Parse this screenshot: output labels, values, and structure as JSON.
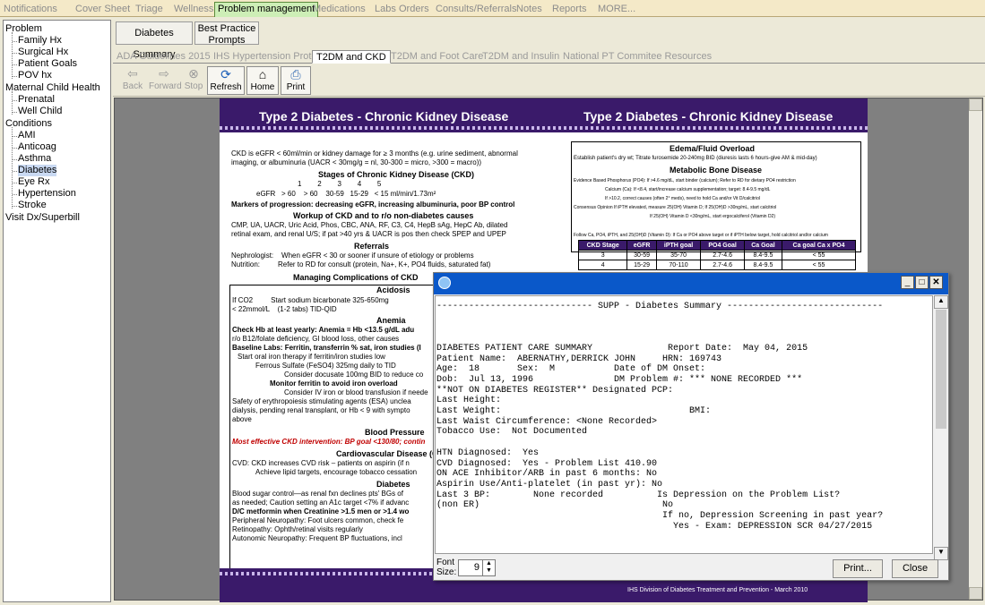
{
  "top_tabs": [
    "Notifications",
    "Cover Sheet",
    "Triage",
    "Wellness",
    "Problem management",
    "Medications",
    "Labs",
    "Orders",
    "Consults/Referrals",
    "Notes",
    "Reports",
    "MORE..."
  ],
  "tree": {
    "problem": "Problem",
    "problem_children": [
      "Family Hx",
      "Surgical Hx",
      "Patient Goals",
      "POV hx"
    ],
    "maternal": "Maternal Child Health",
    "maternal_children": [
      "Prenatal",
      "Well Child"
    ],
    "conditions": "Conditions",
    "condition_children": [
      "AMI",
      "Anticoag",
      "Asthma",
      "Diabetes",
      "Eye Rx",
      "Hypertension",
      "Stroke"
    ],
    "visit": "Visit Dx/Superbill"
  },
  "buttons": {
    "summary": "Diabetes Summary",
    "prompts": "Best Practice Prompts"
  },
  "sub_tabs": [
    "ADA Guidelines 2015",
    "IHS Hypertension Protocol",
    "T2DM and CKD",
    "T2DM and Foot Care",
    "T2DM and Insulin",
    "National PT Commitee Resources"
  ],
  "nav": {
    "back": "Back",
    "forward": "Forward",
    "stop": "Stop",
    "refresh": "Refresh",
    "home": "Home",
    "print": "Print"
  },
  "doc": {
    "title_left": "Type 2 Diabetes - Chronic Kidney Disease",
    "title_right": "Type 2 Diabetes - Chronic Kidney Disease",
    "ckd_def": [
      "CKD is eGFR < 60ml/min or kidney damage for ≥ 3 months (e.g. urine sediment, abnormal",
      "imaging, or albuminuria  (UACR < 30mg/g = nl, 30-300 = micro, >300 = macro))"
    ],
    "stages_title": "Stages of Chronic Kidney Disease (CKD)",
    "stages_nums": "1        2        3        4        5",
    "stages_egfr": "eGFR   > 60    > 60    30-59   15-29   < 15 ml/min/1.73m²",
    "markers": "Markers of progression: decreasing eGFR, increasing albuminuria, poor BP control",
    "workup_title": "Workup of CKD and to r/o non-diabetes causes",
    "workup": [
      "CMP, UA, UACR, Uric Acid, Phos, CBC, ANA, RF, C3, C4, HepB sAg, HepC Ab, dilated",
      "retinal exam, and renal U/S; if pat >40 yrs  & UACR is pos then check SPEP and UPEP"
    ],
    "referrals_title": "Referrals",
    "referrals": [
      "Nephrologist:    When eGFR < 30 or sooner if unsure of etiology or problems",
      "Nutrition:         Refer to RD for consult (protein, Na+, K+, PO4 fluids, saturated fat)"
    ],
    "managing": "Managing Complications of CKD",
    "acidosis_title": "Acidosis",
    "acidosis": [
      "If CO2         Start sodium bicarbonate 325-650mg",
      "< 22mmol/L    (1-2 tabs) TID-QID"
    ],
    "anemia_title": "Anemia",
    "anemia": [
      "Check Hb at least yearly: Anemia = Hb <13.5 g/dL adu",
      "r/o B12/folate deficiency, GI blood loss, other causes",
      "Baseline Labs: Ferritin, transferrin % sat, iron studies (I",
      "Start oral iron therapy if ferritin/iron studies low",
      "Ferrous Sulfate (FeSO4) 325mg daily to TID",
      "Consider docusate 100mg BID to reduce co",
      "Monitor ferritin to avoid iron overload",
      "Consider IV iron or blood transfusion if neede",
      "Safety of erythropoiesis stimulating agents (ESA) unclea",
      "dialysis, pending renal transplant, or Hb < 9 with sympto",
      "above"
    ],
    "bp_title": "Blood Pressure",
    "bp": "Most effective CKD intervention: BP goal <130/80; contin",
    "cvd_title": "Cardiovascular Disease (C",
    "cvd": [
      "CVD: CKD increases CVD risk – patients on aspirin (if n",
      "Achieve lipid targets, encourage tobacco cessation"
    ],
    "dm_title": "Diabetes",
    "dm": [
      "Blood sugar control—as renal fxn declines pts' BGs of",
      "as needed; Caution setting an A1c target <7% if advanc",
      "D/C metformin when Creatinine >1.5 men or >1.4 wo",
      "Peripheral Neuropathy: Foot ulcers common, check fe",
      "Retinopathy: Ophth/retinal visits regularly",
      "Autonomic Neuropathy: Frequent BP fluctuations, incl"
    ],
    "edema_title": "Edema/Fluid Overload",
    "edema": "Establish patient's dry wt; Titrate furosemide 20-240mg BID (diuresis lasts 6 hours-give AM & mid-day)",
    "mbd_title": "Metabolic Bone Disease",
    "mbd": [
      "Evidence Based Phosphorus (PO4): If >4.6 mg/dL, start binder (calcium); Refer to RD for dietary PO4 restriction",
      "Calcium (Ca): If <8.4, start/increase calcium supplementation; target: 8.4-9.5 mg/dL",
      "If >10.2, correct causes (often 2° meds), need to hold Ca and/or Vit D/calcitriol",
      "Consensus Opinion If iPTH elevated, measure 25(OH) Vitamin D; If 25(OH)D >30ng/mL, start calcitriol",
      "If 25(OH) Vitamin D <30ng/mL, start ergocalciferol (Vitamin D2)"
    ],
    "followup": "Follow Ca, PO4, iPTH, and 25(OH)D (Vitamin D): If Ca or PO4 above target or if iPTH below target, hold calcitriol and/or calcium",
    "table_head": [
      "CKD Stage",
      "eGFR",
      "iPTH goal",
      "PO4 Goal",
      "Ca Goal",
      "Ca goal Ca x PO4"
    ],
    "table_rows": [
      [
        "3",
        "30-59",
        "35-70",
        "2.7-4.6",
        "8.4-9.5",
        "< 55"
      ],
      [
        "4",
        "15-29",
        "70-110",
        "2.7-4.6",
        "8.4-9.5",
        "< 55"
      ]
    ],
    "footer": "IHS Division of Diabetes Treatment and Prevention - March 2010"
  },
  "popup": {
    "text": "----------------------------- SUPP - Diabetes Summary -----------------------------\n\n\n\nDIABETES PATIENT CARE SUMMARY              Report Date:  May 04, 2015\nPatient Name:  ABERNATHY,DERRICK JOHN     HRN: 169743\nAge:  18       Sex:  M           Date of DM Onset:\nDob:  Jul 13, 1996               DM Problem #: *** NONE RECORDED ***\n**NOT ON DIABETES REGISTER** Designated PCP:\nLast Height:\nLast Weight:                                   BMI:\nLast Waist Circumference: <None Recorded>\nTobacco Use:  Not Documented\n\nHTN Diagnosed:  Yes\nCVD Diagnosed:  Yes - Problem List 410.90\nON ACE Inhibitor/ARB in past 6 months: No\nAspirin Use/Anti-platelet (in past yr): No\nLast 3 BP:        None recorded          Is Depression on the Problem List?\n(non ER)                                  No\n                                          If no, Depression Screening in past year?\n                                            Yes - Exam: DEPRESSION SCR 04/27/2015",
    "font_label": "Font\nSize:",
    "font_value": "9",
    "print": "Print...",
    "close": "Close"
  }
}
